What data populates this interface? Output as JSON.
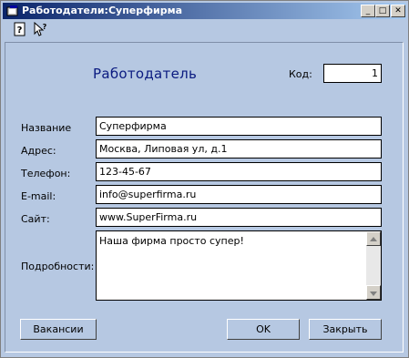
{
  "window": {
    "title": "Работодатели:Суперфирма"
  },
  "titlebar_buttons": {
    "minimize": "_",
    "maximize": "□",
    "close": "✕"
  },
  "form": {
    "heading": "Работодатель",
    "code_label": "Код:",
    "code_value": "1",
    "fields": {
      "name": {
        "label": "Название",
        "value": "Суперфирма"
      },
      "address": {
        "label": "Адрес:",
        "value": "Москва, Липовая ул, д.1"
      },
      "phone": {
        "label": "Телефон:",
        "value": "123-45-67"
      },
      "email": {
        "label": "E-mail:",
        "value": "info@superfirma.ru"
      },
      "site": {
        "label": "Сайт:",
        "value": "www.SuperFirma.ru"
      },
      "details": {
        "label": "Подробности:",
        "value": "Наша фирма просто супер!"
      }
    }
  },
  "buttons": {
    "vacancies": "Вакансии",
    "ok": "OK",
    "close": "Закрыть"
  },
  "colors": {
    "title_gradient_start": "#0a246a",
    "form_background": "#b6c8e2",
    "heading": "#0a1a80"
  }
}
